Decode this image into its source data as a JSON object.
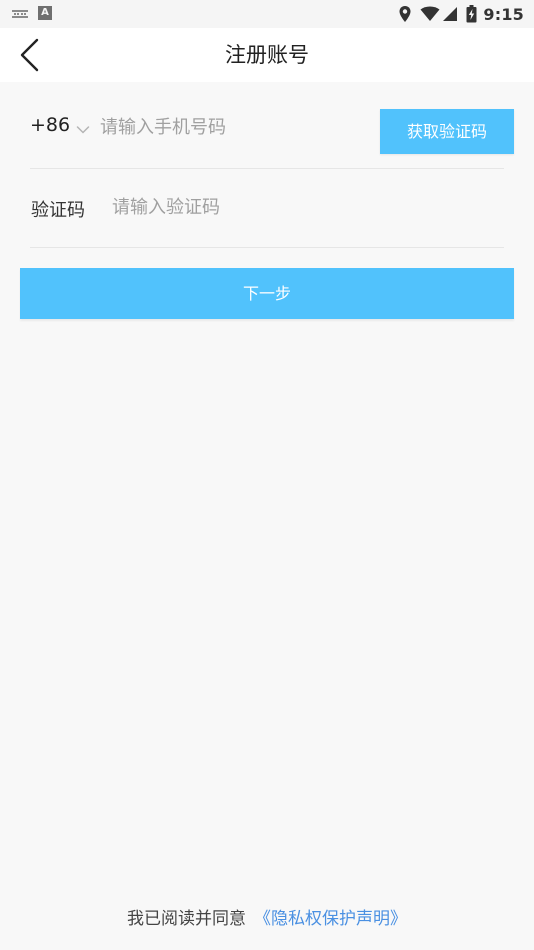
{
  "status_bar": {
    "time": "9:15",
    "keyboard_badge": "A",
    "icons": [
      "keyboard-icon",
      "a-badge-icon",
      "location-icon",
      "wifi-icon",
      "signal-icon",
      "battery-charging-icon"
    ]
  },
  "header": {
    "title": "注册账号",
    "back_icon": "chevron-left-icon"
  },
  "form": {
    "country_code": "+86",
    "country_chevron_icon": "chevron-down-icon",
    "phone_placeholder": "请输入手机号码",
    "phone_value": "",
    "get_code_label": "获取验证码",
    "code_label": "验证码",
    "code_placeholder": "请输入验证码",
    "code_value": "",
    "next_label": "下一步"
  },
  "footer": {
    "agreement_text": "我已阅读并同意",
    "privacy_link": "《隐私权保护声明》"
  },
  "colors": {
    "accent": "#51c2fc",
    "link": "#4a90e2",
    "background": "#f8f8f8"
  }
}
